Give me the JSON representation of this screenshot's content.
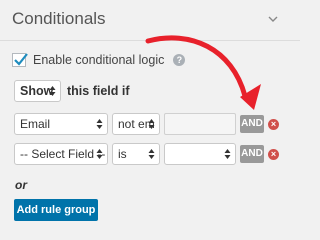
{
  "header": {
    "title": "Conditionals",
    "collapse_icon": "chevron-down-icon"
  },
  "enable": {
    "label": "Enable conditional logic",
    "checked": true,
    "help_glyph": "?"
  },
  "action": {
    "selected": "Show",
    "suffix": "this field if"
  },
  "rules": [
    {
      "field": "Email",
      "operator": "not em",
      "value": "",
      "join": "AND",
      "remove_glyph": "×"
    },
    {
      "field": "-- Select Field --",
      "operator": "is",
      "value": "",
      "join": "AND",
      "remove_glyph": "×"
    }
  ],
  "or_label": "or",
  "add_group_label": "Add rule group",
  "colors": {
    "accent": "#0073aa",
    "annotation_arrow": "#e8212b",
    "remove": "#d0504b"
  }
}
